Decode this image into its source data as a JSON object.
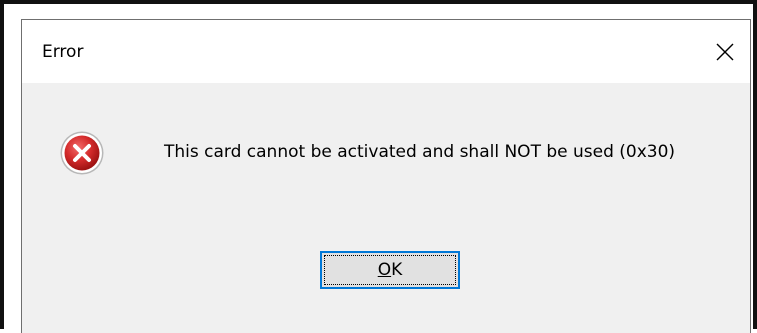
{
  "dialog": {
    "title": "Error",
    "icon": "error-icon",
    "message": "This card cannot be activated and shall NOT be used (0x30)",
    "ok_label_mnemonic": "O",
    "ok_label_rest": "K",
    "close_icon": "close-icon"
  },
  "colors": {
    "dialog_body": "#f0f0f0",
    "titlebar": "#ffffff",
    "button_focus_border": "#0078d7",
    "button_face": "#e1e1e1",
    "error_red": "#c4161c"
  }
}
